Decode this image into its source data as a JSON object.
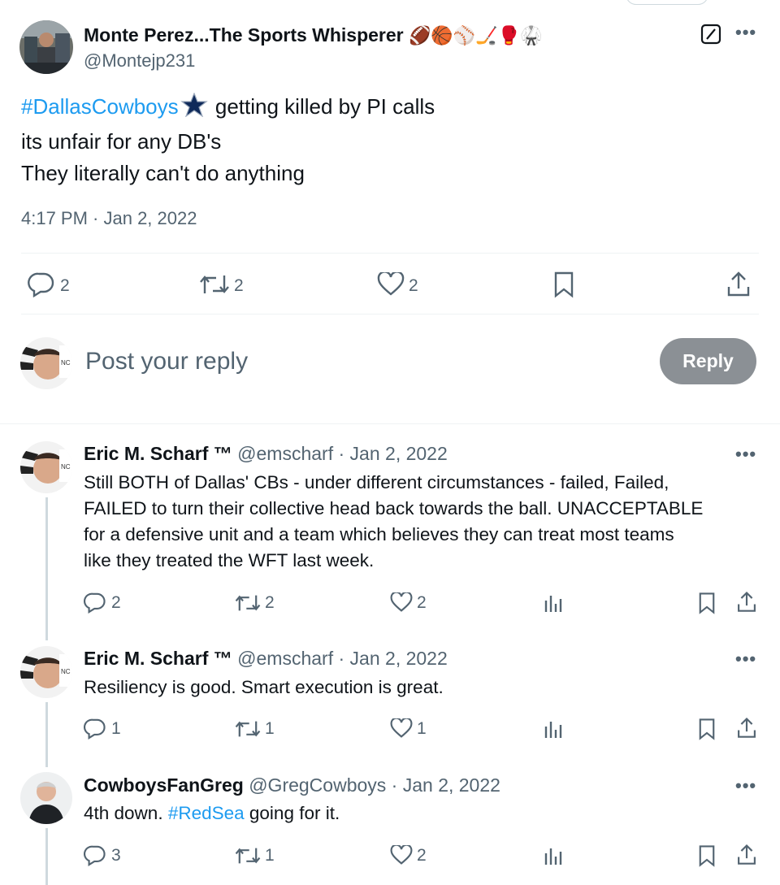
{
  "main_tweet": {
    "author_name": "Monte Perez...The Sports Whisperer",
    "author_emojis": "🏈🏀⚾🏒🥊🥋",
    "handle": "@Montejp231",
    "hashtag": "#DallasCowboys",
    "line1_rest": " getting killed by PI calls",
    "line2": "its unfair for any DB's",
    "line3": "They literally can't do anything",
    "timestamp": "4:17 PM · Jan 2, 2022",
    "stats": {
      "replies": "2",
      "reposts": "2",
      "likes": "2"
    }
  },
  "composer": {
    "placeholder": "Post your reply",
    "button_label": "Reply"
  },
  "replies": [
    {
      "name": "Eric M. Scharf ™",
      "handle": "@emscharf",
      "date": "· Jan 2, 2022",
      "lines": [
        "Still BOTH of Dallas' CBs - under different circumstances - failed, Failed,",
        "FAILED to turn their collective head back towards the ball. UNACCEPTABLE",
        "for a defensive unit and a team which believes they can treat most teams",
        "like they treated the WFT last week."
      ],
      "replies": "2",
      "reposts": "2",
      "likes": "2"
    },
    {
      "name": "Eric M. Scharf ™",
      "handle": "@emscharf",
      "date": "· Jan 2, 2022",
      "text": "Resiliency is good. Smart execution is great.",
      "replies": "1",
      "reposts": "1",
      "likes": "1"
    },
    {
      "name": "CowboysFanGreg",
      "handle": "@GregCowboys",
      "date": "· Jan 2, 2022",
      "text_before": "4th down. ",
      "hashtag": "#RedSea",
      "text_after": " going for it.",
      "replies": "3",
      "reposts": "1",
      "likes": "2"
    }
  ],
  "icons": {
    "more": "more-dots-icon",
    "grok": "grok-icon",
    "reply": "speech-bubble-icon",
    "repost": "repost-arrows-icon",
    "like": "heart-icon",
    "bookmark": "bookmark-icon",
    "share": "share-upload-icon",
    "views": "bar-chart-icon"
  },
  "colors": {
    "link": "#1d9bf0",
    "muted": "#536471",
    "reply_button": "#8b9095"
  }
}
